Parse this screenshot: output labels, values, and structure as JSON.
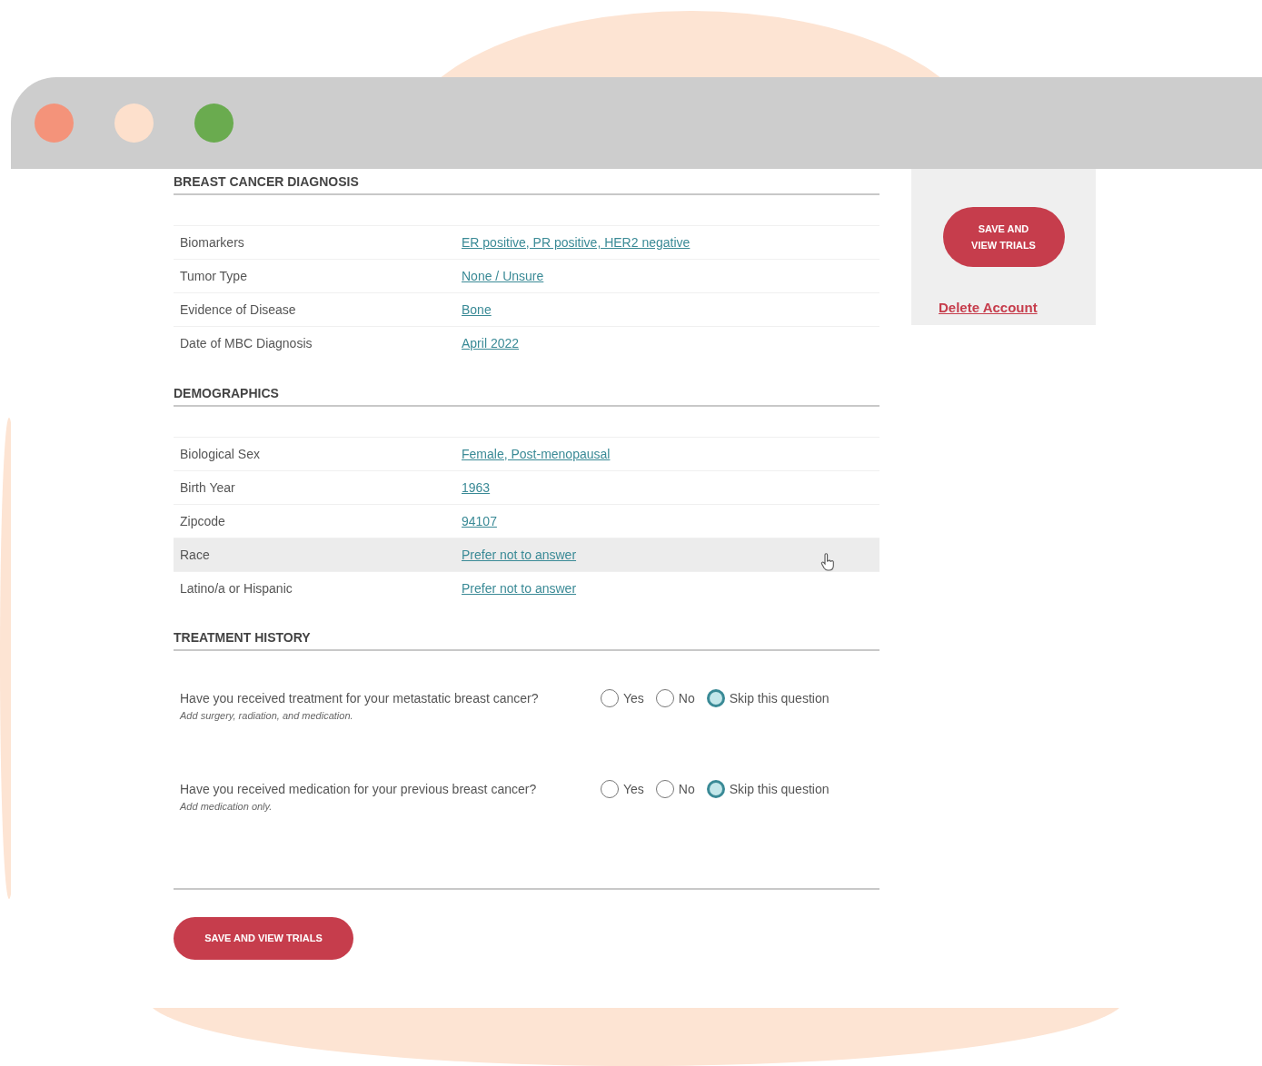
{
  "window": {
    "controls": [
      {
        "color": "#f4937a"
      },
      {
        "color": "#fde0cc"
      },
      {
        "color": "#6aab4f"
      }
    ]
  },
  "sections": [
    {
      "title": "BREAST CANCER DIAGNOSIS",
      "kind": "fields",
      "rows": [
        {
          "label": "Biomarkers",
          "value": "ER positive, PR positive, HER2 negative",
          "highlighted": false
        },
        {
          "label": "Tumor Type",
          "value": "None / Unsure",
          "highlighted": false
        },
        {
          "label": "Evidence of Disease",
          "value": "Bone",
          "highlighted": false
        },
        {
          "label": "Date of MBC Diagnosis",
          "value": "April 2022",
          "highlighted": false
        }
      ]
    },
    {
      "title": "DEMOGRAPHICS",
      "kind": "fields",
      "rows": [
        {
          "label": "Biological Sex",
          "value": "Female, Post-menopausal",
          "highlighted": false
        },
        {
          "label": "Birth Year",
          "value": "1963",
          "highlighted": false
        },
        {
          "label": "Zipcode",
          "value": "94107",
          "highlighted": false
        },
        {
          "label": "Race",
          "value": "Prefer not to answer",
          "highlighted": true
        },
        {
          "label": "Latino/a or Hispanic",
          "value": "Prefer not to answer",
          "highlighted": false
        }
      ]
    },
    {
      "title": "TREATMENT HISTORY",
      "kind": "questions",
      "questions": [
        {
          "text": "Have you received treatment for your metastatic breast cancer?",
          "hint": "Add surgery, radiation, and medication.",
          "options": [
            {
              "label": "Yes",
              "selected": false
            },
            {
              "label": "No",
              "selected": false
            },
            {
              "label": "Skip this question",
              "selected": true
            }
          ]
        },
        {
          "text": "Have you received medication for your previous breast cancer?",
          "hint": "Add medication only.",
          "options": [
            {
              "label": "Yes",
              "selected": false
            },
            {
              "label": "No",
              "selected": false
            },
            {
              "label": "Skip this question",
              "selected": true
            }
          ]
        }
      ]
    }
  ],
  "save_button": "SAVE AND VIEW TRIALS",
  "sidebar": {
    "save_button": "SAVE AND VIEW TRIALS",
    "delete_link": "Delete Account"
  }
}
